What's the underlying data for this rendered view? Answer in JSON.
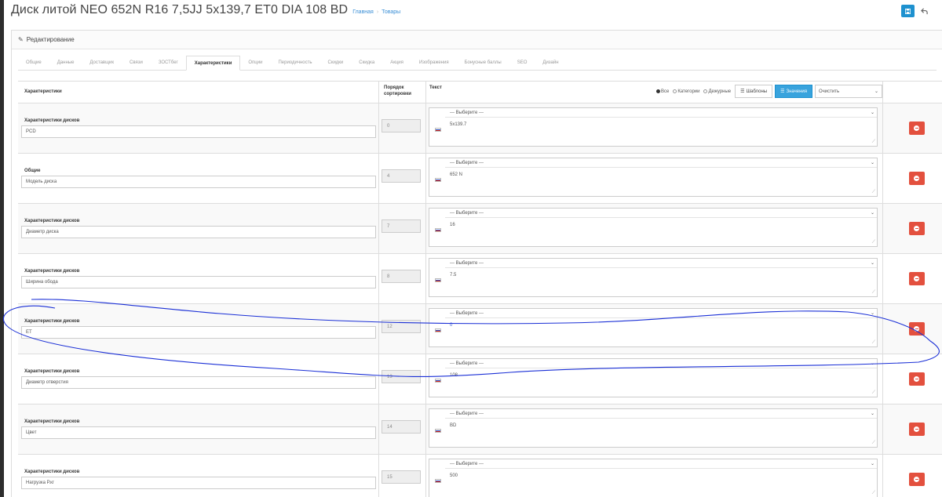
{
  "page": {
    "title": "Диск литой NEO 652N R16 7,5JJ 5x139,7 ET0 DIA 108 BD",
    "breadcrumb": [
      "Главная",
      "Товары"
    ],
    "breadcrumb_sep": "›"
  },
  "panel": {
    "heading": "Редактирование",
    "heading_icon": "pencil-icon"
  },
  "tabs": [
    "Общие",
    "Данные",
    "Доставщик",
    "Связи",
    "ЗОСТбег",
    "Характеристики",
    "Опции",
    "Периодичность",
    "Скидки",
    "Скидка",
    "Акция",
    "Изображения",
    "Бонусные баллы",
    "SEO",
    "Дизайн"
  ],
  "active_tab": "Характеристики",
  "table": {
    "headers": {
      "name": "Характеристики",
      "sort": "Порядок сортировки",
      "text": "Текст"
    },
    "filter": {
      "radios": [
        "Все",
        "Категории",
        "Дежурные"
      ],
      "selected": "Все",
      "templates_button": "Шаблоны",
      "values_button": "Значения",
      "clear_select": "Очистить"
    },
    "select_placeholder": "--- Выберите ---",
    "rows": [
      {
        "group": "Характеристики дисков",
        "attribute": "PCD",
        "sort": "0",
        "value": "5x139.7"
      },
      {
        "group": "Общие",
        "attribute": "Модель диска",
        "sort": "4",
        "value": "652 N"
      },
      {
        "group": "Характеристики дисков",
        "attribute": "Диаметр диска",
        "sort": "7",
        "value": "16"
      },
      {
        "group": "Характеристики дисков",
        "attribute": "Ширина обода",
        "sort": "8",
        "value": "7.5"
      },
      {
        "group": "Характеристики дисков",
        "attribute": "ET",
        "sort": "12",
        "value": "0"
      },
      {
        "group": "Характеристики дисков",
        "attribute": "Диаметр отверстия",
        "sort": "13",
        "value": "108"
      },
      {
        "group": "Характеристики дисков",
        "attribute": "Цвет",
        "sort": "14",
        "value": "BD"
      },
      {
        "group": "Характеристики дисков",
        "attribute": "Нагрузка Р.кг",
        "sort": "15",
        "value": "500"
      }
    ]
  },
  "colors": {
    "primary": "#1e91cf",
    "danger": "#e3503e",
    "annotation": "#1a2fd6"
  }
}
